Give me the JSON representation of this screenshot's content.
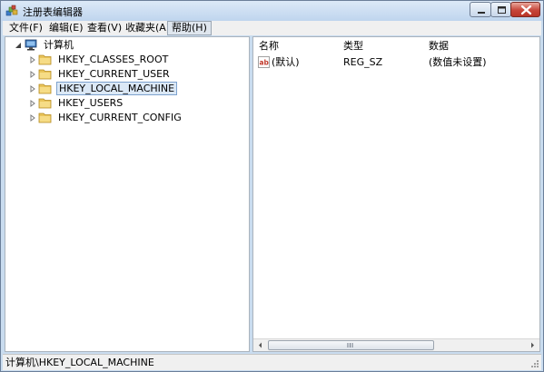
{
  "window": {
    "title": "注册表编辑器",
    "accent": "#c9dcef"
  },
  "menu": [
    "文件(F)",
    "编辑(E)",
    "查看(V)",
    "收藏夹(A)",
    "帮助(H)"
  ],
  "tree": {
    "root": "计算机",
    "items": [
      "HKEY_CLASSES_ROOT",
      "HKEY_CURRENT_USER",
      "HKEY_LOCAL_MACHINE",
      "HKEY_USERS",
      "HKEY_CURRENT_CONFIG"
    ],
    "selected": "HKEY_LOCAL_MACHINE"
  },
  "list": {
    "columns": [
      "名称",
      "类型",
      "数据"
    ],
    "rows": [
      {
        "name": "(默认)",
        "type": "REG_SZ",
        "data": "(数值未设置)"
      }
    ]
  },
  "status": {
    "path": "计算机\\HKEY_LOCAL_MACHINE"
  }
}
